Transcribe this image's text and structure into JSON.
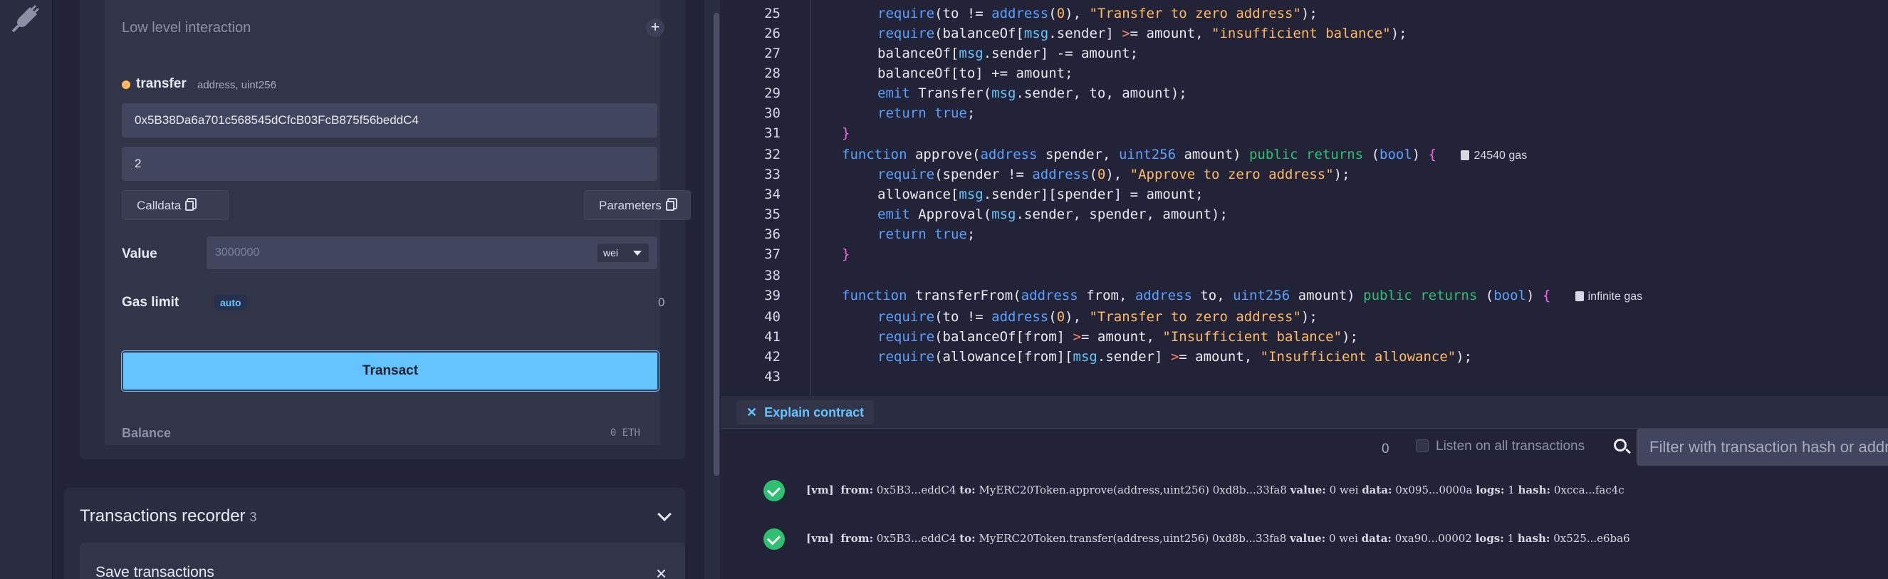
{
  "panel": {
    "low_level_title": "Low level interaction",
    "plus": "+",
    "function_name": "transfer",
    "function_sig": "address, uint256",
    "address_value": "0x5B38Da6a701c568545dCfcB03FcB875f56beddC4",
    "amount_value": "2",
    "calldata_label": "Calldata",
    "parameters_label": "Parameters",
    "value_label": "Value",
    "value_placeholder": "3000000",
    "value_unit": "wei",
    "gas_limit_label": "Gas limit",
    "gas_auto": "auto",
    "gas_value": "0",
    "transact_label": "Transact",
    "balance_label": "Balance",
    "balance_value": "0 ETH"
  },
  "recorder": {
    "title": "Transactions recorder",
    "count": "3",
    "save_title": "Save transactions",
    "close": "×"
  },
  "editor": {
    "line_numbers": [
      "25",
      "26",
      "27",
      "28",
      "29",
      "30",
      "31",
      "32",
      "33",
      "34",
      "35",
      "36",
      "37",
      "38",
      "39",
      "40",
      "41",
      "42",
      "43"
    ],
    "gas_hint_approve": "24540 gas",
    "gas_hint_transferFrom": "infinite gas"
  },
  "explain": {
    "label": "Explain contract"
  },
  "terminal": {
    "count": "0",
    "listen_label": "Listen on all transactions",
    "filter_placeholder": "Filter with transaction hash or address",
    "logs": [
      {
        "vm": "[vm]",
        "from_k": "from:",
        "from": "0x5B3...eddC4",
        "to_k": "to:",
        "to": "MyERC20Token.approve(address,uint256) 0xd8b...33fa8",
        "value_k": "value:",
        "value": "0 wei",
        "data_k": "data:",
        "data": "0x095...0000a",
        "logs_k": "logs:",
        "logs": "1",
        "hash_k": "hash:",
        "hash": "0xcca...fac4c"
      },
      {
        "vm": "[vm]",
        "from_k": "from:",
        "from": "0x5B3...eddC4",
        "to_k": "to:",
        "to": "MyERC20Token.transfer(address,uint256) 0xd8b...33fa8",
        "value_k": "value:",
        "value": "0 wei",
        "data_k": "data:",
        "data": "0xa90...00002",
        "logs_k": "logs:",
        "logs": "1",
        "hash_k": "hash:",
        "hash": "0x525...e6ba6"
      }
    ]
  }
}
